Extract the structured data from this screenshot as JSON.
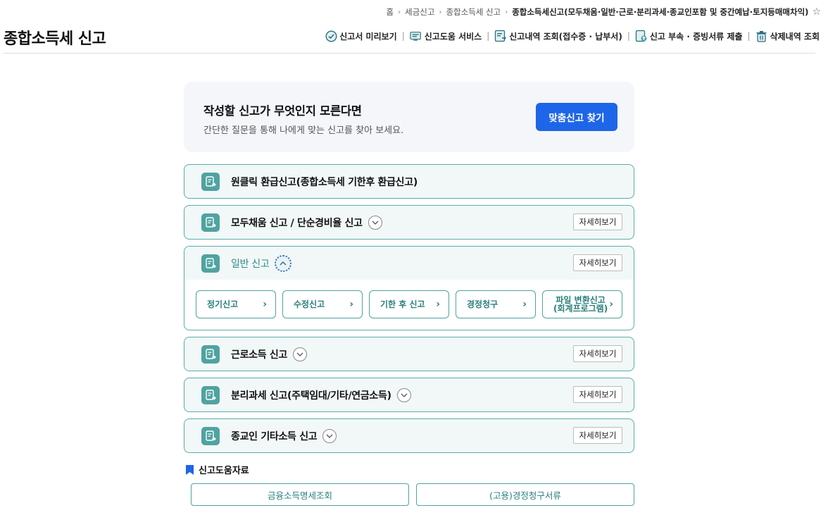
{
  "breadcrumb": {
    "items": [
      "홈",
      "세금신고",
      "종합소득세 신고",
      "종합소득세신고(모두채움·일반·근로·분리과세·종교인포함 및 중간예납·토지등매매차익)"
    ]
  },
  "header": {
    "title": "종합소득세 신고",
    "quick_menu": [
      {
        "label": "신고서 미리보기",
        "icon": "preview-icon"
      },
      {
        "label": "신고도움 서비스",
        "icon": "help-service-icon"
      },
      {
        "label": "신고내역 조회(접수증 · 납부서)",
        "icon": "history-icon"
      },
      {
        "label": "신고 부속 · 증빙서류 제출",
        "icon": "upload-doc-icon"
      },
      {
        "label": "삭제내역 조회",
        "icon": "trash-icon"
      }
    ]
  },
  "finder": {
    "title": "작성할 신고가 무엇인지 모른다면",
    "desc": "간단한 질문을 통해 나에게 맞는 신고를 찾아 보세요.",
    "button": "맞춤신고 찾기"
  },
  "cards": [
    {
      "title": "원클릭 환급신고(종합소득세 기한후 환급신고)"
    },
    {
      "title": "모두채움 신고 / 단순경비율 신고",
      "detail": "자세히보기"
    },
    {
      "title": "일반 신고",
      "detail": "자세히보기",
      "sub_items": [
        "정기신고",
        "수정신고",
        "기한 후 신고",
        "경정청구",
        "파일 변환신고\n(회계프로그램)"
      ]
    },
    {
      "title": "근로소득 신고",
      "detail": "자세히보기"
    },
    {
      "title": "분리과세 신고(주택임대/기타/연금소득)",
      "detail": "자세히보기"
    },
    {
      "title": "종교인 기타소득 신고",
      "detail": "자세히보기"
    }
  ],
  "resources": {
    "title": "신고도움자료",
    "links": [
      "금융소득명세조회",
      "(고용)경정청구서류"
    ]
  },
  "colors": {
    "accent_teal": "#4fa3a0",
    "primary_blue": "#1e66e8"
  }
}
